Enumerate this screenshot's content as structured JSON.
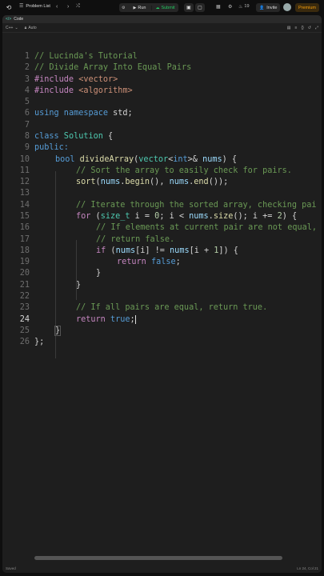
{
  "topbar": {
    "nav_label": "Problem List",
    "run_label": "Run",
    "submit_label": "Submit",
    "streak": "19",
    "invite_label": "Invite",
    "premium_label": "Premium"
  },
  "panel": {
    "title": "Code",
    "language": "C++",
    "mode": "Auto"
  },
  "code": {
    "current_line": 24,
    "lines": [
      "1",
      "2",
      "3",
      "4",
      "5",
      "6",
      "7",
      "8",
      "9",
      "10",
      "11",
      "12",
      "13",
      "14",
      "15",
      "16",
      "17",
      "18",
      "19",
      "20",
      "21",
      "22",
      "23",
      "24",
      "25",
      "26"
    ],
    "text": {
      "l1": "// Lucinda's Tutorial",
      "l2": "// Divide Array Into Equal Pairs",
      "l3_a": "#include",
      "l3_b": " <vector>",
      "l4_a": "#include",
      "l4_b": " <algorithm>",
      "l6_a": "using",
      "l6_b": " namespace",
      "l6_c": " std;",
      "l8_a": "class",
      "l8_b": " Solution",
      "l8_c": " {",
      "l9": "public:",
      "l10_a": "bool",
      "l10_b": " divideArray",
      "l10_c": "(",
      "l10_d": "vector",
      "l10_e": "<",
      "l10_f": "int",
      "l10_g": ">& ",
      "l10_h": "nums",
      "l10_i": ") {",
      "l11": "// Sort the array to easily check for pairs.",
      "l12_a": "sort",
      "l12_b": "(",
      "l12_c": "nums",
      "l12_d": ".",
      "l12_e": "begin",
      "l12_f": "(), ",
      "l12_g": "nums",
      "l12_h": ".",
      "l12_i": "end",
      "l12_j": "());",
      "l14": "// Iterate through the sorted array, checking pai",
      "l15_a": "for",
      "l15_b": " (",
      "l15_c": "size_t",
      "l15_d": " i = ",
      "l15_e": "0",
      "l15_f": "; i < ",
      "l15_g": "nums",
      "l15_h": ".",
      "l15_i": "size",
      "l15_j": "(); i += ",
      "l15_k": "2",
      "l15_l": ") {",
      "l16": "// If elements at current pair are not equal,",
      "l17": "// return false.",
      "l18_a": "if",
      "l18_b": " (",
      "l18_c": "nums",
      "l18_d": "[i] != ",
      "l18_e": "nums",
      "l18_f": "[i + ",
      "l18_g": "1",
      "l18_h": "]) {",
      "l19_a": "return",
      "l19_b": " false",
      "l19_c": ";",
      "l20": "}",
      "l21": "}",
      "l23": "// If all pairs are equal, return true.",
      "l24_a": "return",
      "l24_b": " true",
      "l24_c": ";",
      "l25": "}",
      "l26": "};"
    }
  },
  "status": {
    "left": "Saved",
    "right": "Ln 24, Col 21"
  },
  "colors": {
    "background": "#1e1e1e",
    "comment": "#6a9955",
    "keyword": "#569cd6",
    "run_green": "#22c55e",
    "premium": "#f59e0b"
  }
}
